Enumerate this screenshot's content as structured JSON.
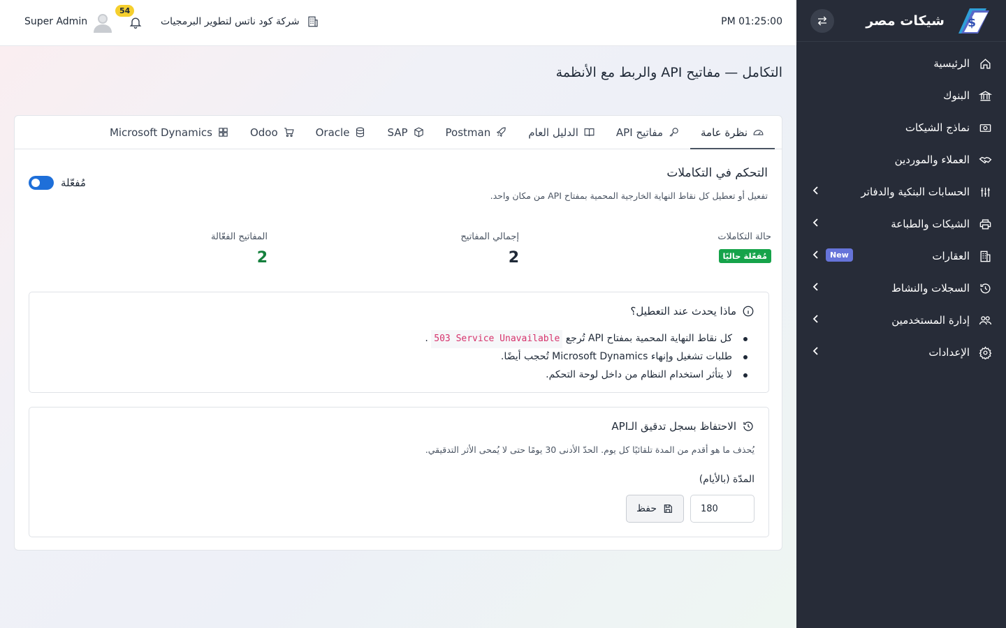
{
  "brand": {
    "name": "شيكات مصر"
  },
  "sidebar": {
    "items": [
      {
        "label": "الرئيسية",
        "icon": "home-icon",
        "chevron": false
      },
      {
        "label": "البنوك",
        "icon": "bank-icon",
        "chevron": false
      },
      {
        "label": "نماذج الشيكات",
        "icon": "cash-icon",
        "chevron": false
      },
      {
        "label": "العملاء والموردين",
        "icon": "handshake-icon",
        "chevron": false
      },
      {
        "label": "الحسابات البنكية والدفاتر",
        "icon": "sliders-icon",
        "chevron": true
      },
      {
        "label": "الشيكات والطباعة",
        "icon": "printer-icon",
        "chevron": true
      },
      {
        "label": "العقارات",
        "icon": "building-icon",
        "chevron": true,
        "badge": "New"
      },
      {
        "label": "السجلات والنشاط",
        "icon": "history-icon",
        "chevron": true
      },
      {
        "label": "إدارة المستخدمين",
        "icon": "users-icon",
        "chevron": true
      },
      {
        "label": "الإعدادات",
        "icon": "gear-icon",
        "chevron": true
      }
    ]
  },
  "topbar": {
    "clock": "PM 01:25:00",
    "company": "شركة كود ناتس لتطوير البرمجيات",
    "notifications": "54",
    "user": "Super Admin"
  },
  "page": {
    "title": "التكامل — مفاتيح API والربط مع الأنظمة"
  },
  "tabs": [
    {
      "label": "نظرة عامة",
      "icon": "gauge-icon",
      "active": true
    },
    {
      "label": "مفاتيح API",
      "icon": "key-icon"
    },
    {
      "label": "الدليل العام",
      "icon": "book-icon"
    },
    {
      "label": "Postman",
      "icon": "rocket-icon"
    },
    {
      "label": "SAP",
      "icon": "box-icon"
    },
    {
      "label": "Oracle",
      "icon": "database-icon"
    },
    {
      "label": "Odoo",
      "icon": "cart-icon"
    },
    {
      "label": "Microsoft Dynamics",
      "icon": "grid-icon"
    }
  ],
  "control": {
    "title": "التحكم في التكاملات",
    "description": "تفعيل أو تعطيل كل نقاط النهاية الخارجية المحمية بمفتاح API من مكان واحد.",
    "toggle_label": "مُفعّلة",
    "toggle_on": true
  },
  "stats": {
    "status_label": "حالة التكاملات",
    "status_badge": "مُفعّلة حاليًا",
    "total_label": "إجمالي المفاتيح",
    "total_value": "2",
    "active_label": "المفاتيح الفعّالة",
    "active_value": "2"
  },
  "disable_info": {
    "title": "ماذا يحدث عند التعطيل؟",
    "bullet1_prefix": "كل نقاط النهاية المحمية بمفتاح API تُرجع",
    "bullet1_code": "503 Service Unavailable",
    "bullet1_suffix": ".",
    "bullet2": "طلبات تشغيل وإنهاء Microsoft Dynamics تُحجب أيضًا.",
    "bullet3": "لا يتأثر استخدام النظام من داخل لوحة التحكم."
  },
  "retention": {
    "title": "الاحتفاظ بسجل تدقيق الـAPI",
    "description": "يُحذف ما هو أقدم من المدة تلقائيًا كل يوم. الحدّ الأدنى 30 يومًا حتى لا يُمحى الأثر التدقيقي.",
    "duration_label": "المدّة (بالأيام)",
    "duration_value": "180",
    "save_label": "حفظ"
  },
  "colors": {
    "sidebar_bg": "#272c38",
    "accent_toggle": "#1e6fd9",
    "success": "#16a34a",
    "stat_green": "#15803d",
    "badge_yellow": "#f5cf2e",
    "new_badge": "#6674d9"
  }
}
